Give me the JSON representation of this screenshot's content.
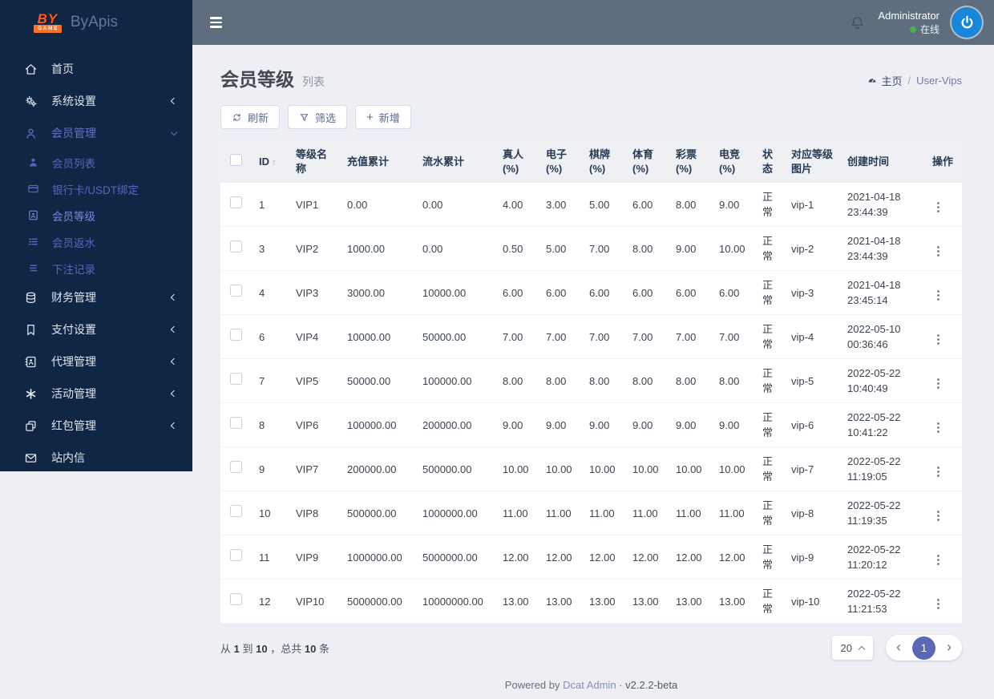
{
  "colors": {
    "sidebar_bg": "#0f2745",
    "topbar_bg": "#5e6e7e",
    "page_bg": "#edeff4",
    "accent_blue": "#5a68b5",
    "menu_active_blue": "#6171c6",
    "logo_orange": "#ff7324",
    "avatar_blue": "#1787dc",
    "online_green": "#4caf50"
  },
  "brand": {
    "logo_primary": "BY",
    "logo_secondary": "GAME",
    "name": "ByApis"
  },
  "topbar": {
    "user_name": "Administrator",
    "user_status": "在线"
  },
  "sidebar": {
    "items": [
      {
        "key": "home",
        "label": "首页",
        "icon": "home-icon",
        "type": "top"
      },
      {
        "key": "system-settings",
        "label": "系统设置",
        "icon": "gears-icon",
        "type": "top",
        "chevron": "left"
      },
      {
        "key": "member-management",
        "label": "会员管理",
        "icon": "user-outline-icon",
        "type": "section",
        "chevron": "down"
      },
      {
        "key": "member-list",
        "label": "会员列表",
        "icon": "user-solid-icon",
        "type": "child"
      },
      {
        "key": "bank-usdt-binding",
        "label": "银行卡/USDT绑定",
        "icon": "credit-card-icon",
        "type": "child"
      },
      {
        "key": "member-levels",
        "label": "会员等级",
        "icon": "id-card-icon",
        "type": "child",
        "active": true
      },
      {
        "key": "member-rebate",
        "label": "会员返水",
        "icon": "list-icon",
        "type": "child"
      },
      {
        "key": "bet-records",
        "label": "下注记录",
        "icon": "stack-icon",
        "type": "child"
      },
      {
        "key": "finance-management",
        "label": "财务管理",
        "icon": "database-icon",
        "type": "top",
        "chevron": "left"
      },
      {
        "key": "payment-settings",
        "label": "支付设置",
        "icon": "bookmark-icon",
        "type": "top",
        "chevron": "left"
      },
      {
        "key": "agent-management",
        "label": "代理管理",
        "icon": "address-book-icon",
        "type": "top",
        "chevron": "left"
      },
      {
        "key": "activity-management",
        "label": "活动管理",
        "icon": "asterisk-icon",
        "type": "top",
        "chevron": "left"
      },
      {
        "key": "redpacket-management",
        "label": "红包管理",
        "icon": "copy-icon",
        "type": "top",
        "chevron": "left"
      },
      {
        "key": "site-mail",
        "label": "站内信",
        "icon": "envelope-icon",
        "type": "top"
      }
    ]
  },
  "page": {
    "title": "会员等级",
    "subtitle": "列表",
    "breadcrumb_home": "主页",
    "breadcrumb_separator": "/",
    "breadcrumb_current": "User-Vips"
  },
  "toolbar": {
    "refresh_label": "刷新",
    "filter_label": "筛选",
    "add_label": "新增",
    "add_icon": "+"
  },
  "table": {
    "sort_icon": "↑",
    "headers": [
      "ID",
      "等级名称",
      "充值累计",
      "流水累计",
      "真人(%)",
      "电子(%)",
      "棋牌(%)",
      "体育(%)",
      "彩票(%)",
      "电竞(%)",
      "状态",
      "对应等级图片",
      "创建时间",
      "操作"
    ],
    "rows": [
      {
        "id": "1",
        "name": "VIP1",
        "recharge": "0.00",
        "flow": "0.00",
        "live": "4.00",
        "slots": "3.00",
        "cards": "5.00",
        "sports": "6.00",
        "lottery": "8.00",
        "esports": "9.00",
        "status": "正常",
        "image": "vip-1",
        "created": "2021-04-18 23:44:39"
      },
      {
        "id": "3",
        "name": "VIP2",
        "recharge": "1000.00",
        "flow": "0.00",
        "live": "0.50",
        "slots": "5.00",
        "cards": "7.00",
        "sports": "8.00",
        "lottery": "9.00",
        "esports": "10.00",
        "status": "正常",
        "image": "vip-2",
        "created": "2021-04-18 23:44:39"
      },
      {
        "id": "4",
        "name": "VIP3",
        "recharge": "3000.00",
        "flow": "10000.00",
        "live": "6.00",
        "slots": "6.00",
        "cards": "6.00",
        "sports": "6.00",
        "lottery": "6.00",
        "esports": "6.00",
        "status": "正常",
        "image": "vip-3",
        "created": "2021-04-18 23:45:14"
      },
      {
        "id": "6",
        "name": "VIP4",
        "recharge": "10000.00",
        "flow": "50000.00",
        "live": "7.00",
        "slots": "7.00",
        "cards": "7.00",
        "sports": "7.00",
        "lottery": "7.00",
        "esports": "7.00",
        "status": "正常",
        "image": "vip-4",
        "created": "2022-05-10 00:36:46"
      },
      {
        "id": "7",
        "name": "VIP5",
        "recharge": "50000.00",
        "flow": "100000.00",
        "live": "8.00",
        "slots": "8.00",
        "cards": "8.00",
        "sports": "8.00",
        "lottery": "8.00",
        "esports": "8.00",
        "status": "正常",
        "image": "vip-5",
        "created": "2022-05-22 10:40:49"
      },
      {
        "id": "8",
        "name": "VIP6",
        "recharge": "100000.00",
        "flow": "200000.00",
        "live": "9.00",
        "slots": "9.00",
        "cards": "9.00",
        "sports": "9.00",
        "lottery": "9.00",
        "esports": "9.00",
        "status": "正常",
        "image": "vip-6",
        "created": "2022-05-22 10:41:22"
      },
      {
        "id": "9",
        "name": "VIP7",
        "recharge": "200000.00",
        "flow": "500000.00",
        "live": "10.00",
        "slots": "10.00",
        "cards": "10.00",
        "sports": "10.00",
        "lottery": "10.00",
        "esports": "10.00",
        "status": "正常",
        "image": "vip-7",
        "created": "2022-05-22 11:19:05"
      },
      {
        "id": "10",
        "name": "VIP8",
        "recharge": "500000.00",
        "flow": "1000000.00",
        "live": "11.00",
        "slots": "11.00",
        "cards": "11.00",
        "sports": "11.00",
        "lottery": "11.00",
        "esports": "11.00",
        "status": "正常",
        "image": "vip-8",
        "created": "2022-05-22 11:19:35"
      },
      {
        "id": "11",
        "name": "VIP9",
        "recharge": "1000000.00",
        "flow": "5000000.00",
        "live": "12.00",
        "slots": "12.00",
        "cards": "12.00",
        "sports": "12.00",
        "lottery": "12.00",
        "esports": "12.00",
        "status": "正常",
        "image": "vip-9",
        "created": "2022-05-22 11:20:12"
      },
      {
        "id": "12",
        "name": "VIP10",
        "recharge": "5000000.00",
        "flow": "10000000.00",
        "live": "13.00",
        "slots": "13.00",
        "cards": "13.00",
        "sports": "13.00",
        "lottery": "13.00",
        "esports": "13.00",
        "status": "正常",
        "image": "vip-10",
        "created": "2022-05-22 11:21:53"
      }
    ]
  },
  "pagination": {
    "summary_from_label": "从",
    "summary_from": "1",
    "summary_to_label": "到",
    "summary_to": "10",
    "summary_total_label": "，总共",
    "summary_total": "10",
    "summary_unit": "条",
    "page_size": "20",
    "current_page": "1",
    "prev_icon": "‹",
    "next_icon": "›"
  },
  "footer": {
    "powered_by": "Powered by",
    "brand_link": "Dcat Admin",
    "separator": "·",
    "version": "v2.2.2-beta"
  }
}
